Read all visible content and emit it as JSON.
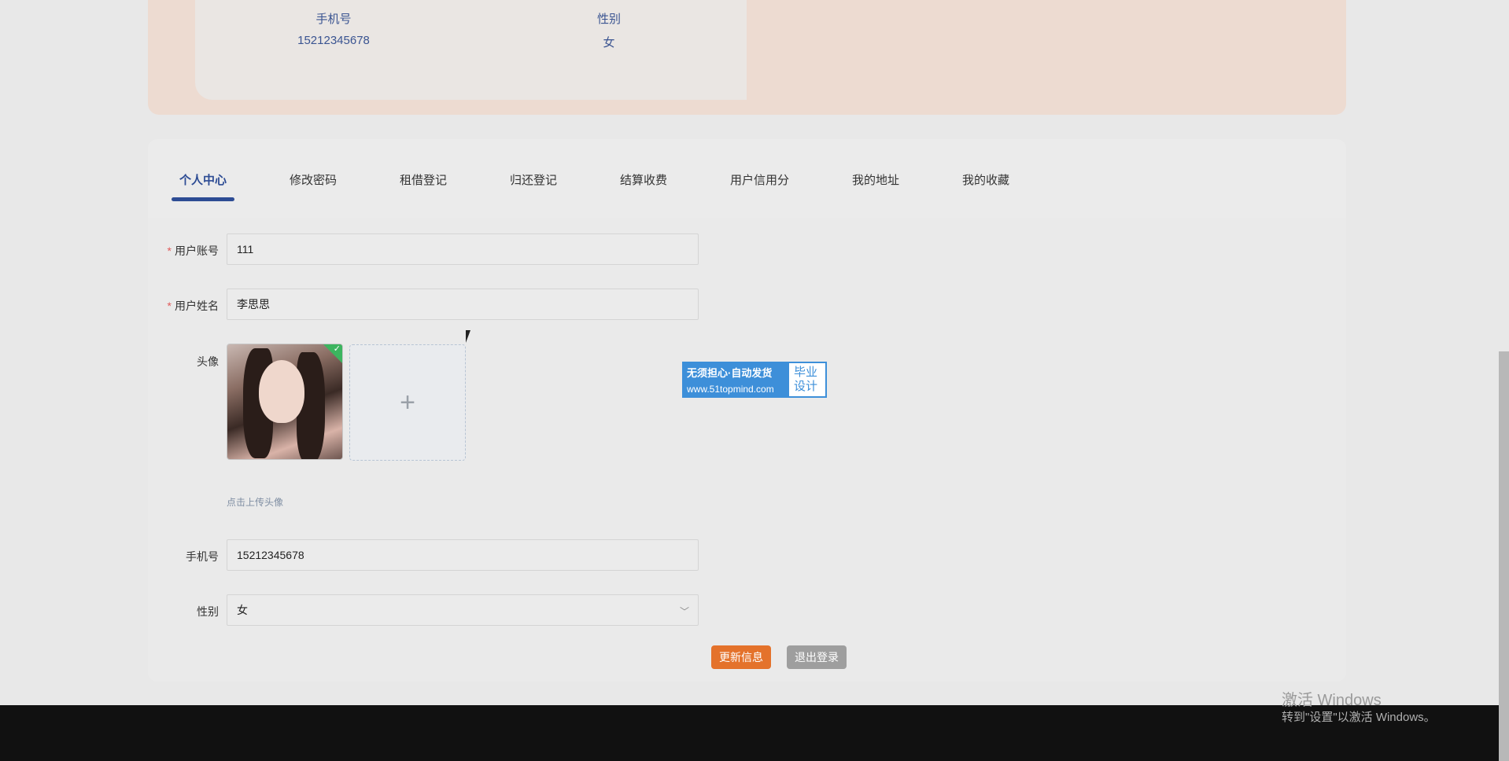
{
  "profile_summary": {
    "phone_label": "手机号",
    "phone_value": "15212345678",
    "gender_label": "性别",
    "gender_value": "女"
  },
  "tabs": [
    {
      "label": "个人中心",
      "active": true
    },
    {
      "label": "修改密码"
    },
    {
      "label": "租借登记"
    },
    {
      "label": "归还登记"
    },
    {
      "label": "结算收费"
    },
    {
      "label": "用户信用分"
    },
    {
      "label": "我的地址"
    },
    {
      "label": "我的收藏"
    }
  ],
  "form": {
    "account": {
      "label": "用户账号",
      "value": "111"
    },
    "name": {
      "label": "用户姓名",
      "value": "李思思"
    },
    "avatar": {
      "label": "头像",
      "hint": "点击上传头像",
      "plus": "+"
    },
    "phone": {
      "label": "手机号",
      "value": "15212345678"
    },
    "gender": {
      "label": "性别",
      "value": "女"
    }
  },
  "buttons": {
    "update": "更新信息",
    "logout": "退出登录"
  },
  "ad": {
    "line1": "无须担心·自动发货",
    "url": "www.51topmind.com",
    "badge1": "毕业",
    "badge2": "设计"
  },
  "windows_activation": {
    "title": "激活 Windows",
    "subtitle": "转到\"设置\"以激活 Windows。"
  },
  "colors": {
    "accent": "#2d4c94",
    "update_button": "#e4722b",
    "logout_button": "#9e9e9e"
  }
}
